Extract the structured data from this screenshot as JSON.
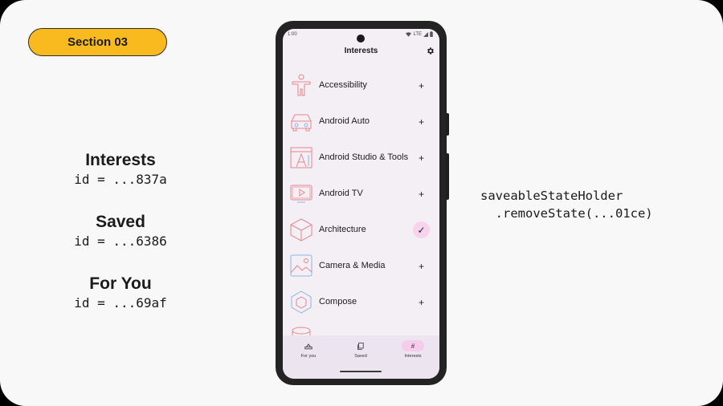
{
  "section_label": "Section 03",
  "destinations": [
    {
      "title": "Interests",
      "id": "id = ...837a"
    },
    {
      "title": "Saved",
      "id": "id = ...6386"
    },
    {
      "title": "For You",
      "id": "id = ...69af"
    }
  ],
  "code": {
    "line1": "saveableStateHolder",
    "line2": "  .removeState(...01ce)"
  },
  "phone": {
    "status_time": "1:00",
    "status_network": "LTE",
    "title": "Interests",
    "settings_icon": "gear-icon",
    "topics": [
      {
        "label": "Accessibility",
        "icon": "accessibility-figure-icon",
        "action": "+"
      },
      {
        "label": "Android Auto",
        "icon": "car-icon",
        "action": "+"
      },
      {
        "label": "Android Studio & Tools",
        "icon": "studio-tools-icon",
        "action": "+"
      },
      {
        "label": "Android TV",
        "icon": "tv-icon",
        "action": "+"
      },
      {
        "label": "Architecture",
        "icon": "cube-icon",
        "action": "✓"
      },
      {
        "label": "Camera & Media",
        "icon": "image-icon",
        "action": "+"
      },
      {
        "label": "Compose",
        "icon": "hexagon-icon",
        "action": "+"
      }
    ],
    "nav": [
      {
        "label": "For you",
        "icon": "for-you-icon"
      },
      {
        "label": "Saved",
        "icon": "bookmarks-icon"
      },
      {
        "label": "Interests",
        "icon": "#",
        "active": true
      }
    ]
  },
  "colors": {
    "accent": "#f8ba1e",
    "slide_bg": "#f8f8f8",
    "screen_bg": "#f4eff5",
    "selected_pill": "#f5cdeb",
    "icon_pink": "#e8868f",
    "icon_blue": "#8fb3e8"
  }
}
